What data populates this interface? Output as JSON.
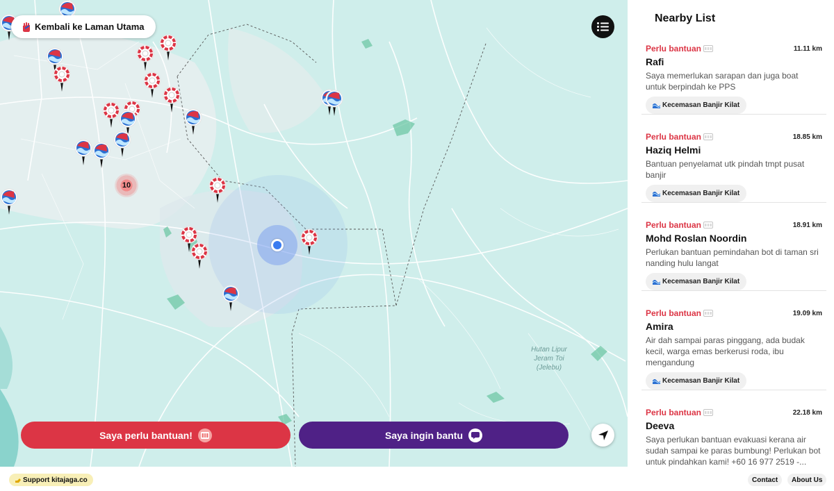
{
  "header": {
    "home_label": "Kembali ke Laman Utama"
  },
  "map": {
    "cluster_count": "10",
    "place_label": "Hutan Lipur Jeram Toi (Jelebu)"
  },
  "actions": {
    "need_help_label": "Saya perlu bantuan!",
    "give_help_label": "Saya ingin bantu"
  },
  "panel": {
    "title": "Nearby List",
    "items": [
      {
        "status": "Perlu bantuan",
        "distance": "11.11 km",
        "name": "Rafi",
        "desc": "Saya memerlukan sarapan dan juga boat untuk berpindah ke PPS",
        "tag": "Kecemasan Banjir Kilat"
      },
      {
        "status": "Perlu bantuan",
        "distance": "18.85 km",
        "name": "Haziq Helmi",
        "desc": "Bantuan penyelamat utk pindah tmpt pusat banjir",
        "tag": "Kecemasan Banjir Kilat"
      },
      {
        "status": "Perlu bantuan",
        "distance": "18.91 km",
        "name": "Mohd Roslan Noordin",
        "desc": "Perlukan bantuan pemindahan bot di taman sri nanding hulu langat",
        "tag": "Kecemasan Banjir Kilat"
      },
      {
        "status": "Perlu bantuan",
        "distance": "19.09 km",
        "name": "Amira",
        "desc": "Air dah sampai paras pinggang, ada budak kecil, warga emas berkerusi roda, ibu mengandung",
        "tag": "Kecemasan Banjir Kilat"
      },
      {
        "status": "Perlu bantuan",
        "distance": "22.18 km",
        "name": "Deeva",
        "desc": "Saya perlukan bantuan evakuasi kerana air sudah sampai ke paras bumbung! Perlukan bot untuk pindahkan kami! +60 16 977 2519 -...",
        "tag": ""
      }
    ]
  },
  "footer": {
    "support_label": "Support kitajaga.co",
    "contact_label": "Contact",
    "about_label": "About Us"
  },
  "colors": {
    "help": "#dc3545",
    "give": "#4f2186",
    "water": "#cfeeeb"
  },
  "icons": {
    "pin_flood": "flood-wave-icon",
    "pin_rescue": "lifebuoy-icon"
  }
}
